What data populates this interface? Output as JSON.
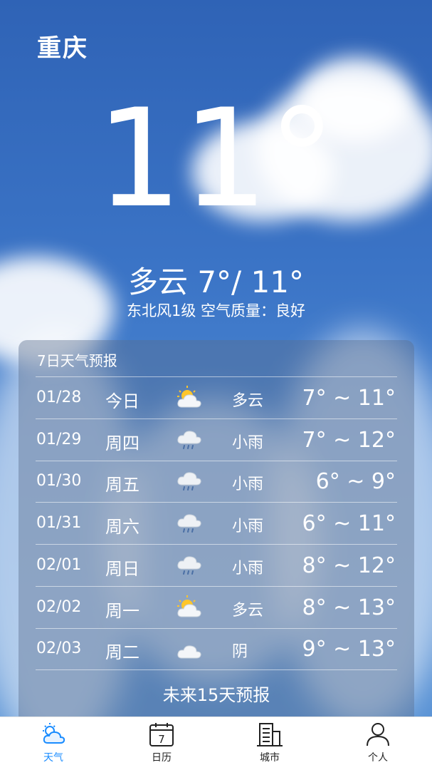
{
  "header": {
    "city": "重庆"
  },
  "current": {
    "temp": "11°",
    "condition_line": "多云 7°/ 11°",
    "detail_line": "东北风1级  空气质量：良好"
  },
  "forecast": {
    "title": "7日天气预报",
    "days": [
      {
        "date": "01/28",
        "day": "今日",
        "icon": "partly-cloudy-icon",
        "cond": "多云",
        "range": "7° ~ 11°"
      },
      {
        "date": "01/29",
        "day": "周四",
        "icon": "light-rain-icon",
        "cond": "小雨",
        "range": "7° ~ 12°"
      },
      {
        "date": "01/30",
        "day": "周五",
        "icon": "light-rain-icon",
        "cond": "小雨",
        "range": "6° ~ 9°"
      },
      {
        "date": "01/31",
        "day": "周六",
        "icon": "light-rain-icon",
        "cond": "小雨",
        "range": "6° ~ 11°"
      },
      {
        "date": "02/01",
        "day": "周日",
        "icon": "light-rain-icon",
        "cond": "小雨",
        "range": "8° ~ 12°"
      },
      {
        "date": "02/02",
        "day": "周一",
        "icon": "partly-cloudy-icon",
        "cond": "多云",
        "range": "8° ~ 13°"
      },
      {
        "date": "02/03",
        "day": "周二",
        "icon": "overcast-icon",
        "cond": "阴",
        "range": "9° ~ 13°"
      }
    ],
    "more_label": "未来15天预报"
  },
  "tabbar": {
    "items": [
      {
        "label": "天气",
        "icon": "weather-icon",
        "active": true
      },
      {
        "label": "日历",
        "icon": "calendar-icon",
        "calendar_day": "7"
      },
      {
        "label": "城市",
        "icon": "city-icon"
      },
      {
        "label": "个人",
        "icon": "person-icon"
      }
    ],
    "active_color": "#1a8cff"
  }
}
